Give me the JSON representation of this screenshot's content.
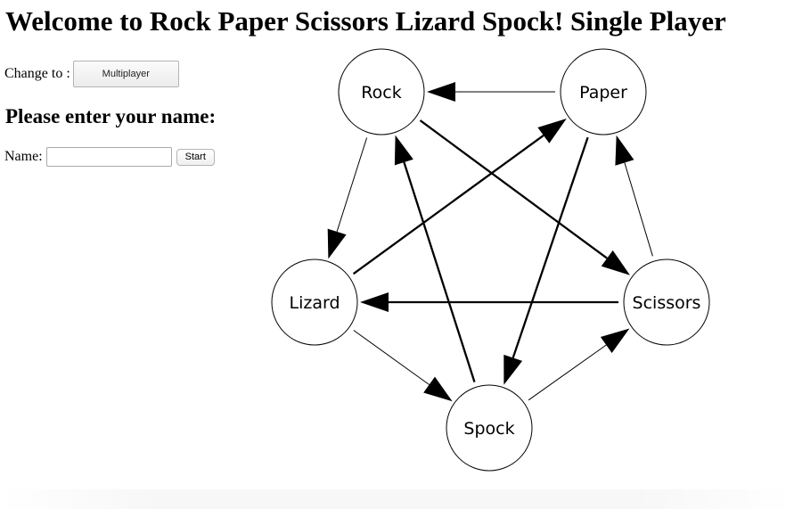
{
  "header": {
    "title": "Welcome to Rock Paper Scissors Lizard Spock! Single Player"
  },
  "mode_switch": {
    "label": "Change to :",
    "button_label": "Multiplayer"
  },
  "name_form": {
    "heading": "Please enter your name:",
    "label": "Name:",
    "value": "",
    "placeholder": "",
    "start_label": "Start"
  },
  "diagram": {
    "nodes": [
      {
        "id": "rock",
        "label": "Rock"
      },
      {
        "id": "paper",
        "label": "Paper"
      },
      {
        "id": "scissors",
        "label": "Scissors"
      },
      {
        "id": "lizard",
        "label": "Lizard"
      },
      {
        "id": "spock",
        "label": "Spock"
      }
    ],
    "edges": [
      {
        "from": "paper",
        "to": "rock"
      },
      {
        "from": "rock",
        "to": "lizard"
      },
      {
        "from": "rock",
        "to": "scissors"
      },
      {
        "from": "lizard",
        "to": "paper"
      },
      {
        "from": "lizard",
        "to": "spock"
      },
      {
        "from": "paper",
        "to": "spock"
      },
      {
        "from": "spock",
        "to": "rock"
      },
      {
        "from": "scissors",
        "to": "paper"
      },
      {
        "from": "scissors",
        "to": "lizard"
      },
      {
        "from": "spock",
        "to": "scissors"
      }
    ]
  }
}
